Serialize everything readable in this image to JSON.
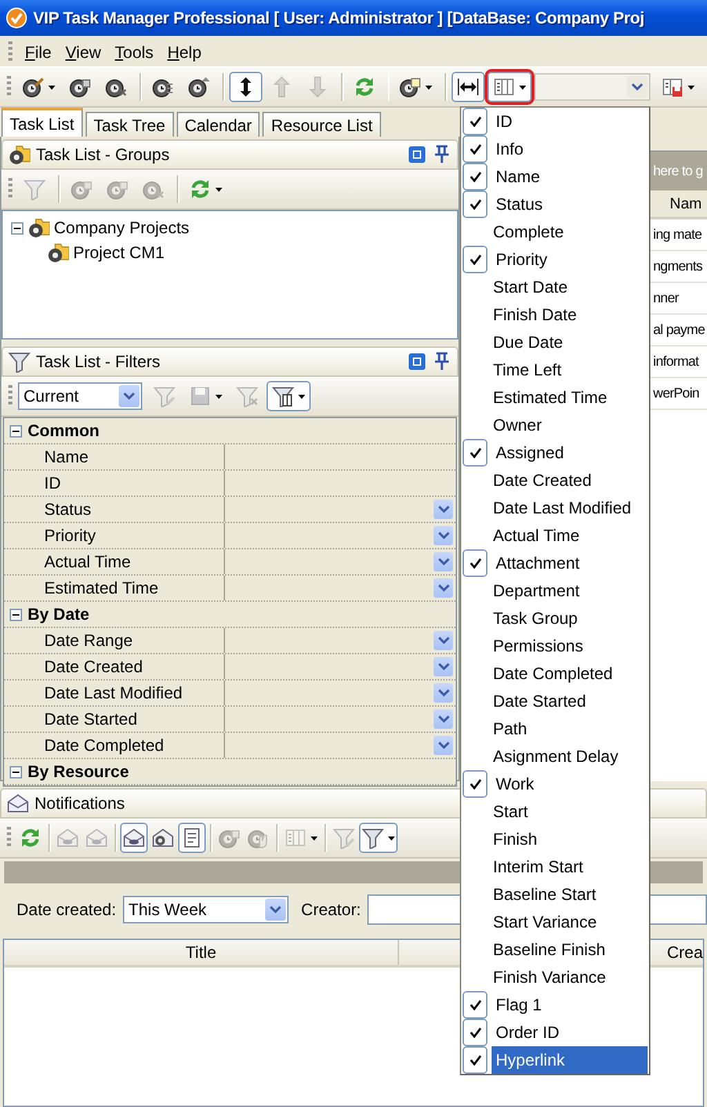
{
  "window": {
    "title": "VIP Task Manager Professional [ User: Administrator ] [DataBase: Company Proj"
  },
  "menu_bar": [
    "File",
    "View",
    "Tools",
    "Help"
  ],
  "main_toolbar": [
    {
      "kind": "dropdown",
      "pressed": false,
      "disabled": false
    },
    {
      "kind": "button",
      "pressed": false,
      "disabled": false
    },
    {
      "kind": "button",
      "pressed": false,
      "disabled": false
    },
    {
      "kind": "separator"
    },
    {
      "kind": "button",
      "pressed": false,
      "disabled": false
    },
    {
      "kind": "button",
      "pressed": false,
      "disabled": false
    },
    {
      "kind": "separator"
    },
    {
      "kind": "button",
      "pressed": true,
      "disabled": false
    },
    {
      "kind": "button",
      "pressed": false,
      "disabled": true
    },
    {
      "kind": "button",
      "pressed": false,
      "disabled": true
    },
    {
      "kind": "separator"
    },
    {
      "kind": "button",
      "pressed": false,
      "disabled": false
    },
    {
      "kind": "separator"
    },
    {
      "kind": "dropdown",
      "pressed": false,
      "disabled": false
    },
    {
      "kind": "separator"
    },
    {
      "kind": "button",
      "pressed": true,
      "disabled": false
    },
    {
      "kind": "dropdown",
      "pressed": true,
      "disabled": false,
      "highlighted": true
    },
    {
      "kind": "combo",
      "disabled": true
    },
    {
      "kind": "dropdown",
      "pressed": false,
      "disabled": false
    }
  ],
  "tabs": [
    {
      "label": "Task List",
      "selected": true
    },
    {
      "label": "Task Tree",
      "selected": false
    },
    {
      "label": "Calendar",
      "selected": false
    },
    {
      "label": "Resource List",
      "selected": false
    }
  ],
  "groups_panel": {
    "title": "Task List - Groups",
    "toolbar": [
      {
        "kind": "button",
        "pressed": false,
        "disabled": true
      },
      {
        "kind": "separator"
      },
      {
        "kind": "button",
        "pressed": false,
        "disabled": true
      },
      {
        "kind": "button",
        "pressed": false,
        "disabled": true
      },
      {
        "kind": "button",
        "pressed": false,
        "disabled": true
      },
      {
        "kind": "separator"
      },
      {
        "kind": "dropdown",
        "pressed": false,
        "disabled": false
      }
    ],
    "tree": [
      {
        "label": "Company Projects",
        "expanded": true,
        "children": [
          {
            "label": "Project CM1"
          }
        ]
      }
    ]
  },
  "filters_panel": {
    "title": "Task List - Filters",
    "toolbar": [
      {
        "kind": "combo",
        "value": "Current",
        "disabled": false
      },
      {
        "kind": "button",
        "pressed": false,
        "disabled": true
      },
      {
        "kind": "dropdown",
        "pressed": false,
        "disabled": true
      },
      {
        "kind": "button",
        "pressed": false,
        "disabled": true
      },
      {
        "kind": "dropdown",
        "pressed": true,
        "disabled": false
      }
    ],
    "grid": [
      {
        "category": "Common",
        "expanded": true,
        "rows": [
          {
            "label": "Name",
            "kind": "text"
          },
          {
            "label": "ID",
            "kind": "text"
          },
          {
            "label": "Status",
            "kind": "dropdown"
          },
          {
            "label": "Priority",
            "kind": "dropdown"
          },
          {
            "label": "Actual Time",
            "kind": "dropdown"
          },
          {
            "label": "Estimated Time",
            "kind": "dropdown"
          }
        ]
      },
      {
        "category": "By Date",
        "expanded": true,
        "rows": [
          {
            "label": "Date Range",
            "kind": "dropdown"
          },
          {
            "label": "Date Created",
            "kind": "dropdown"
          },
          {
            "label": "Date Last Modified",
            "kind": "dropdown"
          },
          {
            "label": "Date Started",
            "kind": "dropdown"
          },
          {
            "label": "Date Completed",
            "kind": "dropdown"
          }
        ]
      },
      {
        "category": "By Resource",
        "expanded": true
      }
    ]
  },
  "task_grid": {
    "group_hint": "here to g",
    "columns": [
      "Nam"
    ],
    "rows": [
      "ing mate",
      "ngments",
      "nner",
      "al payme",
      "informat",
      "werPoin"
    ]
  },
  "notifications": {
    "title": "Notifications",
    "toolbar": [
      {
        "kind": "button",
        "pressed": false,
        "disabled": false
      },
      {
        "kind": "separator"
      },
      {
        "kind": "button",
        "pressed": false,
        "disabled": true
      },
      {
        "kind": "button",
        "pressed": false,
        "disabled": true
      },
      {
        "kind": "separator"
      },
      {
        "kind": "button",
        "pressed": true,
        "disabled": false
      },
      {
        "kind": "button",
        "pressed": false,
        "disabled": false
      },
      {
        "kind": "button",
        "pressed": true,
        "disabled": false
      },
      {
        "kind": "separator"
      },
      {
        "kind": "button",
        "pressed": false,
        "disabled": true
      },
      {
        "kind": "button",
        "pressed": false,
        "disabled": true
      },
      {
        "kind": "separator"
      },
      {
        "kind": "dropdown",
        "pressed": false,
        "disabled": true
      },
      {
        "kind": "separator"
      },
      {
        "kind": "button",
        "pressed": false,
        "disabled": true
      },
      {
        "kind": "dropdown",
        "pressed": true,
        "disabled": false
      }
    ],
    "filter": {
      "date_label": "Date created:",
      "date_value": "This Week",
      "creator_label": "Creator:"
    },
    "columns": [
      {
        "kind": "label",
        "label": "Title"
      },
      {
        "kind": "blank"
      },
      {
        "kind": "label",
        "label": "Crea"
      }
    ]
  },
  "column_menu": {
    "items": [
      {
        "label": "ID",
        "checked": true,
        "selected": false
      },
      {
        "label": "Info",
        "checked": true,
        "selected": false
      },
      {
        "label": "Name",
        "checked": true,
        "selected": false
      },
      {
        "label": "Status",
        "checked": true,
        "selected": false
      },
      {
        "label": "Complete",
        "checked": false,
        "selected": false
      },
      {
        "label": "Priority",
        "checked": true,
        "selected": false
      },
      {
        "label": "Start Date",
        "checked": false,
        "selected": false
      },
      {
        "label": "Finish Date",
        "checked": false,
        "selected": false
      },
      {
        "label": "Due Date",
        "checked": false,
        "selected": false
      },
      {
        "label": "Time Left",
        "checked": false,
        "selected": false
      },
      {
        "label": "Estimated Time",
        "checked": false,
        "selected": false
      },
      {
        "label": "Owner",
        "checked": false,
        "selected": false
      },
      {
        "label": "Assigned",
        "checked": true,
        "selected": false
      },
      {
        "label": "Date Created",
        "checked": false,
        "selected": false
      },
      {
        "label": "Date Last Modified",
        "checked": false,
        "selected": false
      },
      {
        "label": "Actual Time",
        "checked": false,
        "selected": false
      },
      {
        "label": "Attachment",
        "checked": true,
        "selected": false
      },
      {
        "label": "Department",
        "checked": false,
        "selected": false
      },
      {
        "label": "Task Group",
        "checked": false,
        "selected": false
      },
      {
        "label": "Permissions",
        "checked": false,
        "selected": false
      },
      {
        "label": "Date Completed",
        "checked": false,
        "selected": false
      },
      {
        "label": "Date Started",
        "checked": false,
        "selected": false
      },
      {
        "label": "Path",
        "checked": false,
        "selected": false
      },
      {
        "label": "Asignment Delay",
        "checked": false,
        "selected": false
      },
      {
        "label": "Work",
        "checked": true,
        "selected": false
      },
      {
        "label": "Start",
        "checked": false,
        "selected": false
      },
      {
        "label": "Finish",
        "checked": false,
        "selected": false
      },
      {
        "label": "Interim Start",
        "checked": false,
        "selected": false
      },
      {
        "label": "Baseline Start",
        "checked": false,
        "selected": false
      },
      {
        "label": "Start Variance",
        "checked": false,
        "selected": false
      },
      {
        "label": "Baseline Finish",
        "checked": false,
        "selected": false
      },
      {
        "label": "Finish Variance",
        "checked": false,
        "selected": false
      },
      {
        "label": "Flag 1",
        "checked": true,
        "selected": false
      },
      {
        "label": "Order ID",
        "checked": true,
        "selected": false
      },
      {
        "label": "Hyperlink",
        "checked": true,
        "selected": true
      }
    ]
  }
}
